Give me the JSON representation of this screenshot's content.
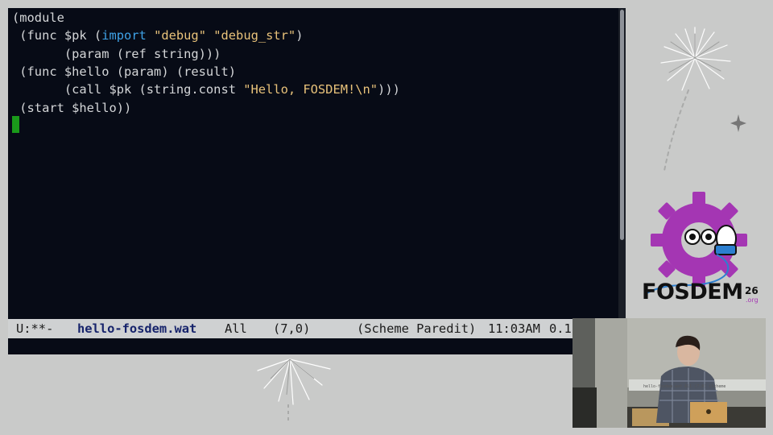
{
  "editor": {
    "lines": [
      [
        {
          "t": "(module",
          "c": ""
        }
      ],
      [
        {
          "t": " (func $pk (",
          "c": ""
        },
        {
          "t": "import",
          "c": "kw"
        },
        {
          "t": " ",
          "c": ""
        },
        {
          "t": "\"debug\"",
          "c": "str"
        },
        {
          "t": " ",
          "c": ""
        },
        {
          "t": "\"debug_str\"",
          "c": "str"
        },
        {
          "t": ")",
          "c": ""
        }
      ],
      [
        {
          "t": "       (param (ref string)))",
          "c": ""
        }
      ],
      [
        {
          "t": " (func $hello (param) (result)",
          "c": ""
        }
      ],
      [
        {
          "t": "       (call $pk (string.const ",
          "c": ""
        },
        {
          "t": "\"Hello, FOSDEM!\\n\"",
          "c": "str"
        },
        {
          "t": ")))",
          "c": ""
        }
      ],
      [
        {
          "t": " (start $hello))",
          "c": ""
        }
      ]
    ],
    "colors": {
      "background": "#070b16",
      "text": "#d4d6d8",
      "keyword": "#3fa3e8",
      "string": "#e8c27a",
      "cursor": "#1a9a1a"
    }
  },
  "modeline": {
    "status": "U:**-",
    "buffer": "hello-fosdem.wat",
    "position": "All",
    "line_col": "(7,0)",
    "modes": "(Scheme Paredit)",
    "time": "11:03AM",
    "load": "0.1"
  },
  "logo": {
    "word": "FOSDEM",
    "year": "26",
    "tld": ".org",
    "accent": "#a436b3"
  },
  "camera": {
    "screen_text": "hello-fosdem.wat  All  (7,0)  (Scheme"
  }
}
